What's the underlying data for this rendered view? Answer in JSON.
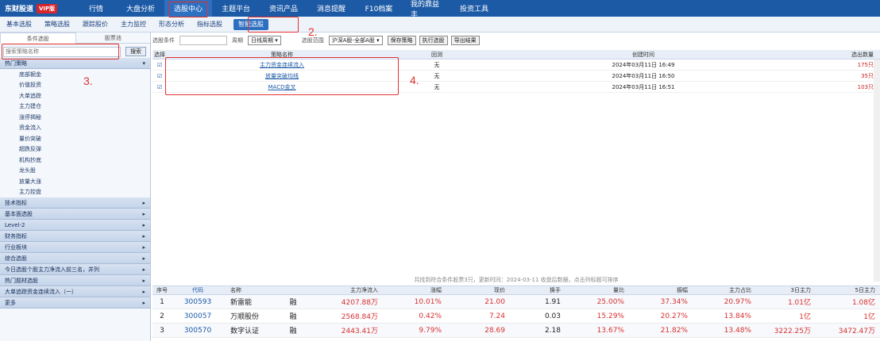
{
  "topnav": {
    "logo": "东财股道",
    "badge": "VIP版",
    "items": [
      "行情",
      "大盘分析",
      "选股中心",
      "主题平台",
      "资讯产品",
      "消息提醒",
      "F10档案",
      "我的鼎益丰",
      "投资工具"
    ],
    "active_index": 2
  },
  "subbar": {
    "items": [
      "基本选股",
      "策略选股",
      "跟踪股价",
      "主力监控",
      "形态分析",
      "指标选股",
      "智能选股"
    ],
    "active_index": 6
  },
  "annotations": [
    "2.",
    "3.",
    "4."
  ],
  "left": {
    "tabs": [
      "条件选股",
      "股票池"
    ],
    "search_placeholder": "搜索策略名称",
    "search_button": "搜索",
    "categories": [
      {
        "label": "热门策略",
        "expanded": true,
        "children": [
          "底部掘金",
          "价值投资",
          "大单追踪",
          "主力建仓",
          "涨停揭秘",
          "资金流入",
          "量价突破",
          "超跌反弹",
          "机构抄底",
          "龙头股",
          "放量大涨",
          "主力控盘"
        ]
      },
      {
        "label": "技术指标"
      },
      {
        "label": "基本面选股"
      },
      {
        "label": "Level-2"
      },
      {
        "label": "财务指标"
      },
      {
        "label": "行业板块"
      },
      {
        "label": "综合选股"
      },
      {
        "label": "今日选股个股主力净流入前三名，并列"
      },
      {
        "label": "热门题材选股"
      },
      {
        "label": "大单追踪资金连续流入（一）"
      },
      {
        "label": "更多"
      }
    ]
  },
  "mainrow": {
    "label1": "选股条件",
    "label2": "周期",
    "period": "日线周期",
    "label3": "选股范围",
    "range": "沪深A股-全部A股",
    "btn1": "保存策略",
    "btn2": "执行选股",
    "btn3": "导出结果"
  },
  "strategy_table": {
    "headers": [
      "选择",
      "策略名称",
      "回测",
      "创建时间",
      "选出数量"
    ],
    "rows": [
      {
        "check": "☑",
        "name": "主力资金连续流入",
        "backtest": "无",
        "time": "2024年03月11日 16:49",
        "count": "175只"
      },
      {
        "check": "☑",
        "name": "放量突破均线",
        "backtest": "无",
        "time": "2024年03月11日 16:50",
        "count": "35只"
      },
      {
        "check": "☑",
        "name": "MACD金叉",
        "backtest": "无",
        "time": "2024年03月11日 16:51",
        "count": "103只"
      }
    ]
  },
  "stocks": {
    "info": "共找到符合条件股票3只，更新时间：2024-03-11 收盘后数据，点击列标题可排序",
    "headers": [
      "序号",
      "代码",
      "名称",
      "",
      "主力净流入",
      "涨幅",
      "现价",
      "换手",
      "量比",
      "振幅",
      "主力占比",
      "3日主力",
      "5日主力"
    ],
    "rows": [
      {
        "no": "1",
        "code": "300593",
        "name": "新雷能",
        "flag": "融",
        "inflow": "4207.88万",
        "pct": "10.01%",
        "price": "21.00",
        "turnover": "1.91",
        "vr": "25.00%",
        "amp": "37.34%",
        "ratio": "20.97%",
        "d3": "1.01亿",
        "d5": "1.08亿"
      },
      {
        "no": "2",
        "code": "300057",
        "name": "万顺股份",
        "flag": "融",
        "inflow": "2568.84万",
        "pct": "0.42%",
        "price": "7.24",
        "turnover": "0.03",
        "vr": "15.29%",
        "amp": "20.27%",
        "ratio": "13.84%",
        "d3": "1亿",
        "d5": "1亿"
      },
      {
        "no": "3",
        "code": "300570",
        "name": "数字认证",
        "flag": "融",
        "inflow": "2443.41万",
        "pct": "9.79%",
        "price": "28.69",
        "turnover": "2.18",
        "vr": "13.67%",
        "amp": "21.82%",
        "ratio": "13.48%",
        "d3": "3222.25万",
        "d5": "3472.47万"
      }
    ]
  }
}
